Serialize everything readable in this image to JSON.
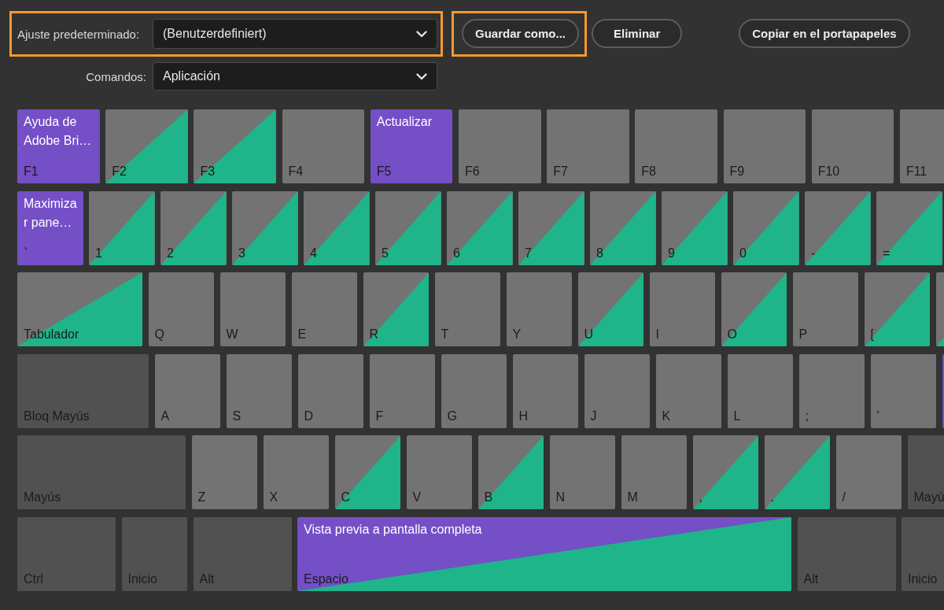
{
  "toolbar": {
    "preset": {
      "label": "Ajuste predeterminado:",
      "value": "(Benutzerdefiniert)",
      "highlighted": true
    },
    "buttons": [
      {
        "label": "Guardar como...",
        "highlighted": true
      },
      {
        "label": "Eliminar",
        "highlighted": false
      },
      {
        "label": "Copiar en el portapapeles",
        "highlighted": false
      }
    ],
    "commands": {
      "label": "Comandos:",
      "value": "Aplicación"
    }
  },
  "keyboard": {
    "rows": [
      {
        "keys": [
          {
            "label": "F1",
            "kind": "key",
            "command": "Ayuda de Adobe Bri…",
            "command_assigned": true,
            "modifier_assigned": false
          },
          {
            "label": "F2",
            "kind": "key",
            "command_assigned": false,
            "modifier_assigned": true
          },
          {
            "label": "F3",
            "kind": "key",
            "command_assigned": false,
            "modifier_assigned": true
          },
          {
            "label": "F4",
            "kind": "key",
            "command_assigned": false,
            "modifier_assigned": false
          },
          {
            "label": "F5",
            "kind": "key",
            "command": "Actualizar",
            "command_assigned": true,
            "modifier_assigned": false
          },
          {
            "label": "F6",
            "kind": "key",
            "command_assigned": false,
            "modifier_assigned": false
          },
          {
            "label": "F7",
            "kind": "key",
            "command_assigned": false,
            "modifier_assigned": false
          },
          {
            "label": "F8",
            "kind": "key",
            "command_assigned": false,
            "modifier_assigned": false
          },
          {
            "label": "F9",
            "kind": "key",
            "command_assigned": false,
            "modifier_assigned": false
          },
          {
            "label": "F10",
            "kind": "key",
            "command_assigned": false,
            "modifier_assigned": false
          },
          {
            "label": "F11",
            "kind": "key",
            "command_assigned": false,
            "modifier_assigned": false
          }
        ]
      },
      {
        "keys": [
          {
            "label": "`",
            "kind": "key",
            "command": "Maximizar pane…",
            "command_assigned": true,
            "modifier_assigned": false
          },
          {
            "label": "1",
            "kind": "key",
            "command_assigned": false,
            "modifier_assigned": true
          },
          {
            "label": "2",
            "kind": "key",
            "command_assigned": false,
            "modifier_assigned": true
          },
          {
            "label": "3",
            "kind": "key",
            "command_assigned": false,
            "modifier_assigned": true
          },
          {
            "label": "4",
            "kind": "key",
            "command_assigned": false,
            "modifier_assigned": true
          },
          {
            "label": "5",
            "kind": "key",
            "command_assigned": false,
            "modifier_assigned": true
          },
          {
            "label": "6",
            "kind": "key",
            "command_assigned": false,
            "modifier_assigned": true
          },
          {
            "label": "7",
            "kind": "key",
            "command_assigned": false,
            "modifier_assigned": true
          },
          {
            "label": "8",
            "kind": "key",
            "command_assigned": false,
            "modifier_assigned": true
          },
          {
            "label": "9",
            "kind": "key",
            "command_assigned": false,
            "modifier_assigned": true
          },
          {
            "label": "0",
            "kind": "key",
            "command_assigned": false,
            "modifier_assigned": true
          },
          {
            "label": "-",
            "kind": "key",
            "command_assigned": false,
            "modifier_assigned": true
          },
          {
            "label": "=",
            "kind": "key",
            "command_assigned": false,
            "modifier_assigned": true
          }
        ]
      },
      {
        "keys": [
          {
            "label": "Tabulador",
            "kind": "key",
            "command_assigned": false,
            "modifier_assigned": true
          },
          {
            "label": "Q",
            "kind": "key",
            "command_assigned": false,
            "modifier_assigned": false
          },
          {
            "label": "W",
            "kind": "key",
            "command_assigned": false,
            "modifier_assigned": false
          },
          {
            "label": "E",
            "kind": "key",
            "command_assigned": false,
            "modifier_assigned": false
          },
          {
            "label": "R",
            "kind": "key",
            "command_assigned": false,
            "modifier_assigned": true
          },
          {
            "label": "T",
            "kind": "key",
            "command_assigned": false,
            "modifier_assigned": false
          },
          {
            "label": "Y",
            "kind": "key",
            "command_assigned": false,
            "modifier_assigned": false
          },
          {
            "label": "U",
            "kind": "key",
            "command_assigned": false,
            "modifier_assigned": true
          },
          {
            "label": "I",
            "kind": "key",
            "command_assigned": false,
            "modifier_assigned": false
          },
          {
            "label": "O",
            "kind": "key",
            "command_assigned": false,
            "modifier_assigned": true
          },
          {
            "label": "P",
            "kind": "key",
            "command_assigned": false,
            "modifier_assigned": false
          },
          {
            "label": "[",
            "kind": "key",
            "command_assigned": false,
            "modifier_assigned": true
          },
          {
            "kind": "key",
            "command_assigned": false,
            "modifier_assigned": true
          }
        ]
      },
      {
        "keys": [
          {
            "label": "Bloq Mayús",
            "kind": "modifier",
            "command_assigned": false,
            "modifier_assigned": false
          },
          {
            "label": "A",
            "kind": "key",
            "command_assigned": false,
            "modifier_assigned": false
          },
          {
            "label": "S",
            "kind": "key",
            "command_assigned": false,
            "modifier_assigned": false
          },
          {
            "label": "D",
            "kind": "key",
            "command_assigned": false,
            "modifier_assigned": false
          },
          {
            "label": "F",
            "kind": "key",
            "command_assigned": false,
            "modifier_assigned": false
          },
          {
            "label": "G",
            "kind": "key",
            "command_assigned": false,
            "modifier_assigned": false
          },
          {
            "label": "H",
            "kind": "key",
            "command_assigned": false,
            "modifier_assigned": false
          },
          {
            "label": "J",
            "kind": "key",
            "command_assigned": false,
            "modifier_assigned": false
          },
          {
            "label": "K",
            "kind": "key",
            "command_assigned": false,
            "modifier_assigned": false
          },
          {
            "label": "L",
            "kind": "key",
            "command_assigned": false,
            "modifier_assigned": false
          },
          {
            "label": ";",
            "kind": "key",
            "command_assigned": false,
            "modifier_assigned": false
          },
          {
            "label": "'",
            "kind": "key",
            "command_assigned": false,
            "modifier_assigned": false
          },
          {
            "kind": "key",
            "command_assigned": true,
            "modifier_assigned": false
          }
        ]
      },
      {
        "keys": [
          {
            "label": "Mayús",
            "kind": "modifier",
            "command_assigned": false,
            "modifier_assigned": false
          },
          {
            "label": "Z",
            "kind": "key",
            "command_assigned": false,
            "modifier_assigned": false
          },
          {
            "label": "X",
            "kind": "key",
            "command_assigned": false,
            "modifier_assigned": false
          },
          {
            "label": "C",
            "kind": "key",
            "command_assigned": false,
            "modifier_assigned": true
          },
          {
            "label": "V",
            "kind": "key",
            "command_assigned": false,
            "modifier_assigned": false
          },
          {
            "label": "B",
            "kind": "key",
            "command_assigned": false,
            "modifier_assigned": true
          },
          {
            "label": "N",
            "kind": "key",
            "command_assigned": false,
            "modifier_assigned": false
          },
          {
            "label": "M",
            "kind": "key",
            "command_assigned": false,
            "modifier_assigned": false
          },
          {
            "label": ",",
            "kind": "key",
            "command_assigned": false,
            "modifier_assigned": true
          },
          {
            "label": ".",
            "kind": "key",
            "command_assigned": false,
            "modifier_assigned": true
          },
          {
            "label": "/",
            "kind": "key",
            "command_assigned": false,
            "modifier_assigned": false
          },
          {
            "label": "Mayú",
            "kind": "modifier",
            "command_assigned": false,
            "modifier_assigned": false
          }
        ]
      },
      {
        "keys": [
          {
            "label": "Ctrl",
            "kind": "modifier",
            "command_assigned": false,
            "modifier_assigned": false
          },
          {
            "label": "Inicio",
            "kind": "modifier",
            "command_assigned": false,
            "modifier_assigned": false
          },
          {
            "label": "Alt",
            "kind": "modifier",
            "command_assigned": false,
            "modifier_assigned": false
          },
          {
            "label": "Espacio",
            "kind": "key",
            "command": "Vista previa a pantalla completa",
            "command_assigned": true,
            "modifier_assigned": true
          },
          {
            "label": "Alt",
            "kind": "modifier",
            "command_assigned": false,
            "modifier_assigned": false
          },
          {
            "label": "Inicio",
            "kind": "modifier",
            "command_assigned": false,
            "modifier_assigned": false
          }
        ]
      }
    ]
  }
}
